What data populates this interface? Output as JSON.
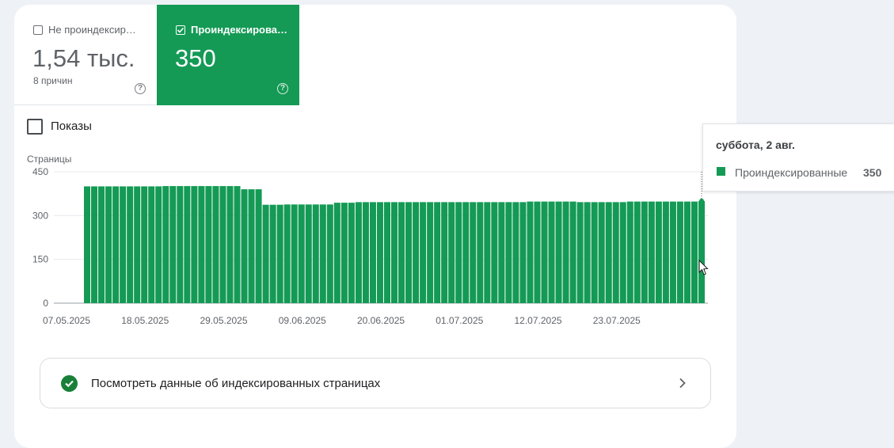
{
  "tiles": {
    "not_indexed": {
      "label": "Не проиндексир…",
      "value": "1,54 тыс.",
      "sub": "8 причин",
      "checked": false
    },
    "indexed": {
      "label": "Проиндексирова…",
      "value": "350",
      "checked": true
    }
  },
  "impressions": {
    "label": "Показы",
    "checked": false
  },
  "link_row": {
    "label": "Посмотреть данные об индексированных страницах"
  },
  "tooltip": {
    "date": "суббота, 2 авг.",
    "series": "Проиндексированные",
    "value": "350"
  },
  "chart_data": {
    "type": "bar",
    "ylabel": "Страницы",
    "ylim": [
      0,
      450
    ],
    "yticks": [
      "450",
      "300",
      "150",
      "0"
    ],
    "xticks": [
      "07.05.2025",
      "18.05.2025",
      "29.05.2025",
      "09.06.2025",
      "20.06.2025",
      "01.07.2025",
      "12.07.2025",
      "23.07.2025"
    ],
    "color": "#149a55",
    "series": [
      {
        "values": [
          400,
          400,
          400,
          400,
          400,
          400,
          400,
          400,
          400,
          400,
          400,
          401,
          401,
          401,
          401,
          401,
          401,
          401,
          401,
          401,
          401,
          401,
          390,
          390,
          390,
          337,
          337,
          337,
          338,
          338,
          338,
          338,
          338,
          338,
          338,
          344,
          344,
          344,
          346,
          346,
          346,
          346,
          346,
          346,
          346,
          346,
          346,
          346,
          346,
          346,
          346,
          346,
          346,
          346,
          346,
          346,
          346,
          346,
          346,
          346,
          346,
          346,
          348,
          348,
          348,
          348,
          348,
          348,
          348,
          346,
          346,
          346,
          346,
          346,
          346,
          346,
          348,
          348,
          348,
          348,
          348,
          348,
          348,
          348,
          348,
          348,
          350
        ]
      }
    ]
  }
}
